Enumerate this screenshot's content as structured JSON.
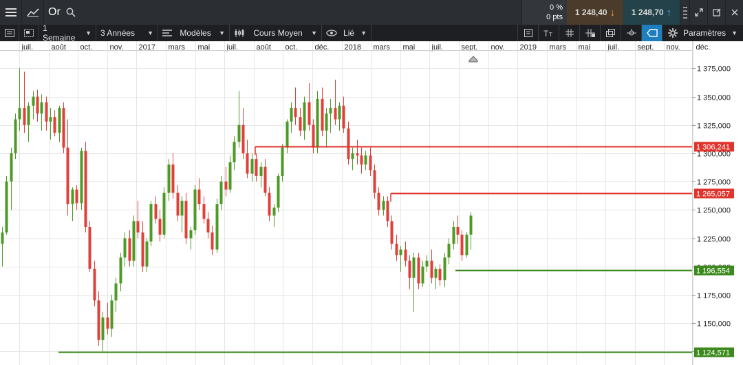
{
  "topbar": {
    "symbol": "Or",
    "change_pct": "0 %",
    "change_pts": "0 pts",
    "sell_price": "1 248,40",
    "buy_price": "1 248,70",
    "sell_arrow": "↓",
    "buy_arrow": "↑"
  },
  "toolbar": {
    "period": "1 Semaine",
    "range": "3 Années",
    "templates": "Modèles",
    "chart_type": "Cours Moyen",
    "link": "Lié",
    "settings": "Paramètres"
  },
  "colors": {
    "up": "#4e9a26",
    "down": "#e0403a",
    "resistance": "#e0342c",
    "support": "#3c8a1e",
    "grid": "#e6e6e6",
    "topbar": "#2b2e33",
    "toolbar": "#1d1f23",
    "active_tool": "#1d7fbf"
  },
  "chart_data": {
    "type": "candlestick",
    "y_axis_ticks": [
      "1 375,000",
      "1 350,000",
      "1 325,000",
      "1 300,000",
      "1 275,000",
      "1 250,000",
      "1 225,000",
      "1 200,000",
      "1 175,000",
      "1 150,000",
      "1 125,000"
    ],
    "y_tick_values": [
      1375,
      1350,
      1325,
      1300,
      1275,
      1250,
      1225,
      1200,
      1175,
      1150,
      1125
    ],
    "ylim": [
      1113,
      1388
    ],
    "x_labels": [
      "juil.",
      "août",
      "oct.",
      "nov.",
      "2017",
      "mars",
      "mai",
      "juil.",
      "août",
      "oct.",
      "déc.",
      "2018",
      "mars",
      "mai",
      "juil.",
      "sept.",
      "nov.",
      "2019",
      "mars",
      "mai",
      "juil.",
      "sept.",
      "nov.",
      "déc."
    ],
    "levels": [
      {
        "value": 1306.241,
        "label": "1 306,241",
        "kind": "resistance"
      },
      {
        "value": 1265.057,
        "label": "1 265,057",
        "kind": "resistance"
      },
      {
        "value": 1196.554,
        "label": "1 196,554",
        "kind": "support"
      },
      {
        "value": 1124.571,
        "label": "1 124,571",
        "kind": "support"
      }
    ],
    "candles": [
      [
        1220,
        1235,
        1200,
        1230
      ],
      [
        1230,
        1280,
        1228,
        1275
      ],
      [
        1275,
        1305,
        1250,
        1300
      ],
      [
        1300,
        1335,
        1295,
        1330
      ],
      [
        1330,
        1375,
        1320,
        1340
      ],
      [
        1340,
        1372,
        1318,
        1325
      ],
      [
        1325,
        1345,
        1310,
        1342
      ],
      [
        1342,
        1355,
        1330,
        1350
      ],
      [
        1350,
        1356,
        1328,
        1335
      ],
      [
        1335,
        1352,
        1320,
        1345
      ],
      [
        1345,
        1350,
        1320,
        1328
      ],
      [
        1328,
        1340,
        1312,
        1332
      ],
      [
        1332,
        1338,
        1315,
        1318
      ],
      [
        1318,
        1342,
        1310,
        1340
      ],
      [
        1340,
        1345,
        1300,
        1305
      ],
      [
        1305,
        1330,
        1245,
        1255
      ],
      [
        1255,
        1270,
        1240,
        1268
      ],
      [
        1268,
        1272,
        1250,
        1256
      ],
      [
        1256,
        1305,
        1250,
        1302
      ],
      [
        1302,
        1310,
        1230,
        1235
      ],
      [
        1235,
        1240,
        1195,
        1198
      ],
      [
        1198,
        1205,
        1165,
        1170
      ],
      [
        1170,
        1178,
        1130,
        1135
      ],
      [
        1135,
        1160,
        1125,
        1155
      ],
      [
        1155,
        1168,
        1140,
        1145
      ],
      [
        1145,
        1175,
        1138,
        1170
      ],
      [
        1170,
        1190,
        1160,
        1185
      ],
      [
        1185,
        1212,
        1178,
        1208
      ],
      [
        1208,
        1230,
        1200,
        1225
      ],
      [
        1225,
        1232,
        1200,
        1205
      ],
      [
        1205,
        1245,
        1200,
        1240
      ],
      [
        1240,
        1258,
        1225,
        1230
      ],
      [
        1230,
        1240,
        1195,
        1200
      ],
      [
        1200,
        1225,
        1195,
        1222
      ],
      [
        1222,
        1258,
        1218,
        1255
      ],
      [
        1255,
        1262,
        1238,
        1242
      ],
      [
        1242,
        1250,
        1222,
        1228
      ],
      [
        1228,
        1270,
        1225,
        1265
      ],
      [
        1265,
        1295,
        1258,
        1290
      ],
      [
        1290,
        1300,
        1260,
        1265
      ],
      [
        1265,
        1272,
        1240,
        1245
      ],
      [
        1245,
        1262,
        1230,
        1258
      ],
      [
        1258,
        1265,
        1220,
        1225
      ],
      [
        1225,
        1235,
        1215,
        1232
      ],
      [
        1232,
        1272,
        1228,
        1268
      ],
      [
        1268,
        1278,
        1250,
        1255
      ],
      [
        1255,
        1262,
        1238,
        1242
      ],
      [
        1242,
        1248,
        1225,
        1230
      ],
      [
        1230,
        1236,
        1210,
        1215
      ],
      [
        1215,
        1260,
        1212,
        1255
      ],
      [
        1255,
        1280,
        1250,
        1275
      ],
      [
        1275,
        1288,
        1262,
        1268
      ],
      [
        1268,
        1298,
        1265,
        1292
      ],
      [
        1292,
        1315,
        1285,
        1310
      ],
      [
        1310,
        1355,
        1305,
        1325
      ],
      [
        1325,
        1340,
        1295,
        1300
      ],
      [
        1300,
        1312,
        1278,
        1282
      ],
      [
        1282,
        1300,
        1275,
        1295
      ],
      [
        1295,
        1300,
        1275,
        1280
      ],
      [
        1280,
        1292,
        1270,
        1288
      ],
      [
        1288,
        1295,
        1262,
        1265
      ],
      [
        1265,
        1270,
        1240,
        1245
      ],
      [
        1245,
        1255,
        1235,
        1252
      ],
      [
        1252,
        1282,
        1248,
        1280
      ],
      [
        1280,
        1308,
        1275,
        1305
      ],
      [
        1305,
        1330,
        1300,
        1328
      ],
      [
        1328,
        1345,
        1318,
        1340
      ],
      [
        1340,
        1358,
        1325,
        1332
      ],
      [
        1332,
        1340,
        1315,
        1320
      ],
      [
        1320,
        1350,
        1312,
        1345
      ],
      [
        1345,
        1362,
        1320,
        1325
      ],
      [
        1325,
        1330,
        1300,
        1305
      ],
      [
        1305,
        1355,
        1300,
        1348
      ],
      [
        1348,
        1358,
        1315,
        1320
      ],
      [
        1320,
        1340,
        1305,
        1335
      ],
      [
        1335,
        1348,
        1318,
        1340
      ],
      [
        1340,
        1365,
        1325,
        1330
      ],
      [
        1330,
        1345,
        1320,
        1342
      ],
      [
        1342,
        1350,
        1318,
        1322
      ],
      [
        1322,
        1328,
        1290,
        1295
      ],
      [
        1295,
        1305,
        1285,
        1300
      ],
      [
        1300,
        1312,
        1290,
        1298
      ],
      [
        1298,
        1305,
        1282,
        1290
      ],
      [
        1290,
        1302,
        1285,
        1298
      ],
      [
        1298,
        1305,
        1280,
        1285
      ],
      [
        1285,
        1290,
        1260,
        1265
      ],
      [
        1265,
        1270,
        1245,
        1250
      ],
      [
        1250,
        1262,
        1245,
        1258
      ],
      [
        1258,
        1262,
        1235,
        1240
      ],
      [
        1240,
        1245,
        1215,
        1220
      ],
      [
        1220,
        1228,
        1205,
        1210
      ],
      [
        1210,
        1218,
        1195,
        1215
      ],
      [
        1215,
        1222,
        1200,
        1205
      ],
      [
        1205,
        1210,
        1180,
        1190
      ],
      [
        1190,
        1212,
        1160,
        1208
      ],
      [
        1208,
        1212,
        1180,
        1185
      ],
      [
        1185,
        1205,
        1182,
        1200
      ],
      [
        1200,
        1210,
        1195,
        1205
      ],
      [
        1205,
        1215,
        1185,
        1190
      ],
      [
        1190,
        1200,
        1180,
        1198
      ],
      [
        1198,
        1202,
        1183,
        1188
      ],
      [
        1188,
        1212,
        1182,
        1208
      ],
      [
        1208,
        1225,
        1202,
        1220
      ],
      [
        1220,
        1240,
        1215,
        1235
      ],
      [
        1235,
        1245,
        1220,
        1228
      ],
      [
        1228,
        1232,
        1205,
        1210
      ],
      [
        1210,
        1230,
        1208,
        1228
      ],
      [
        1228,
        1248,
        1215,
        1245
      ]
    ]
  }
}
